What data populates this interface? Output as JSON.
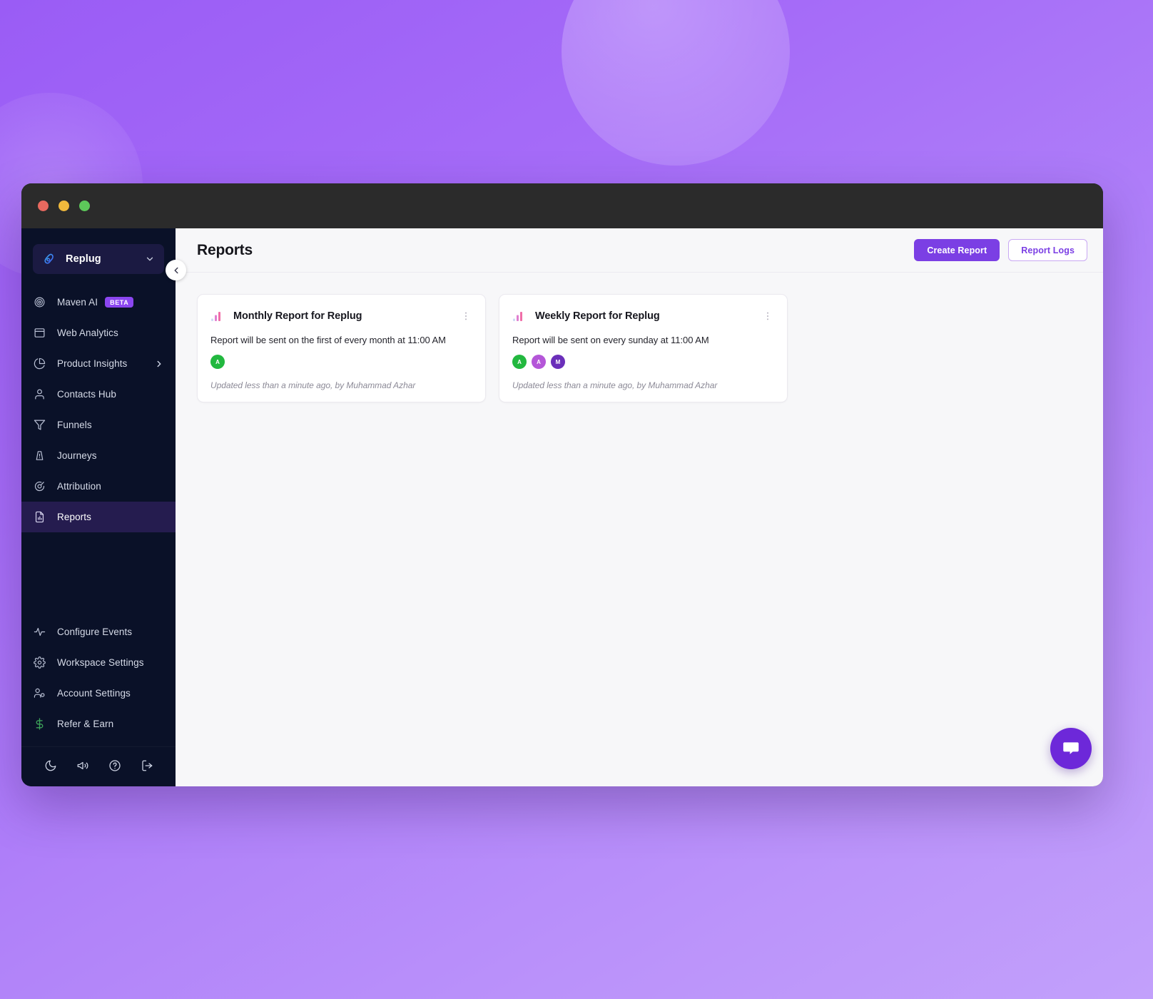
{
  "window": {
    "traffic_lights": [
      "close",
      "minimize",
      "maximize"
    ]
  },
  "sidebar": {
    "workspace": {
      "name": "Replug",
      "logo_icon": "replug-logo-icon",
      "chevron_icon": "chevron-down-icon"
    },
    "collapse_icon": "chevron-left-icon",
    "primary_items": [
      {
        "label": "Maven AI",
        "icon": "maven-ai-icon",
        "badge": "BETA",
        "active": false
      },
      {
        "label": "Web Analytics",
        "icon": "browser-window-icon",
        "active": false
      },
      {
        "label": "Product Insights",
        "icon": "pie-chart-icon",
        "caret": "chevron-right-icon",
        "active": false
      },
      {
        "label": "Contacts Hub",
        "icon": "user-icon",
        "active": false
      },
      {
        "label": "Funnels",
        "icon": "funnel-icon",
        "active": false
      },
      {
        "label": "Journeys",
        "icon": "journey-icon",
        "active": false
      },
      {
        "label": "Attribution",
        "icon": "attribution-target-icon",
        "active": false
      },
      {
        "label": "Reports",
        "icon": "report-document-icon",
        "active": true
      }
    ],
    "secondary_items": [
      {
        "label": "Configure Events",
        "icon": "activity-pulse-icon"
      },
      {
        "label": "Workspace Settings",
        "icon": "gear-icon"
      },
      {
        "label": "Account Settings",
        "icon": "user-settings-icon"
      },
      {
        "label": "Refer & Earn",
        "icon": "dollar-icon"
      }
    ],
    "bottom_icons": [
      {
        "name": "moon-icon"
      },
      {
        "name": "megaphone-icon"
      },
      {
        "name": "help-circle-icon"
      },
      {
        "name": "logout-icon"
      }
    ]
  },
  "header": {
    "title": "Reports",
    "create_report_label": "Create Report",
    "report_logs_label": "Report Logs"
  },
  "cards": [
    {
      "icon": "bar-chart-icon",
      "title": "Monthly Report for Replug",
      "description": "Report will be sent on the first of every month at 11:00 AM",
      "menu_icon": "more-vertical-icon",
      "avatars": [
        {
          "initial": "A",
          "color": "#22b83f"
        }
      ],
      "footer": "Updated less than a minute ago, by Muhammad Azhar"
    },
    {
      "icon": "bar-chart-icon",
      "title": "Weekly Report for Replug",
      "description": "Report will be sent on every sunday at 11:00 AM",
      "menu_icon": "more-vertical-icon",
      "avatars": [
        {
          "initial": "A",
          "color": "#22b83f"
        },
        {
          "initial": "A",
          "color": "#b456d8"
        },
        {
          "initial": "M",
          "color": "#6b2fba"
        }
      ],
      "footer": "Updated less than a minute ago, by Muhammad Azhar"
    }
  ],
  "chat_widget": {
    "icon": "chat-bubble-icon"
  },
  "colors": {
    "accent": "#7b3fe4",
    "sidebar_bg": "#0a1128",
    "active_nav": "#251c4f",
    "badge_beta": "#8b46f0",
    "desktop_gradient_start": "#9a5cf5",
    "desktop_gradient_end": "#c2a0fb"
  }
}
